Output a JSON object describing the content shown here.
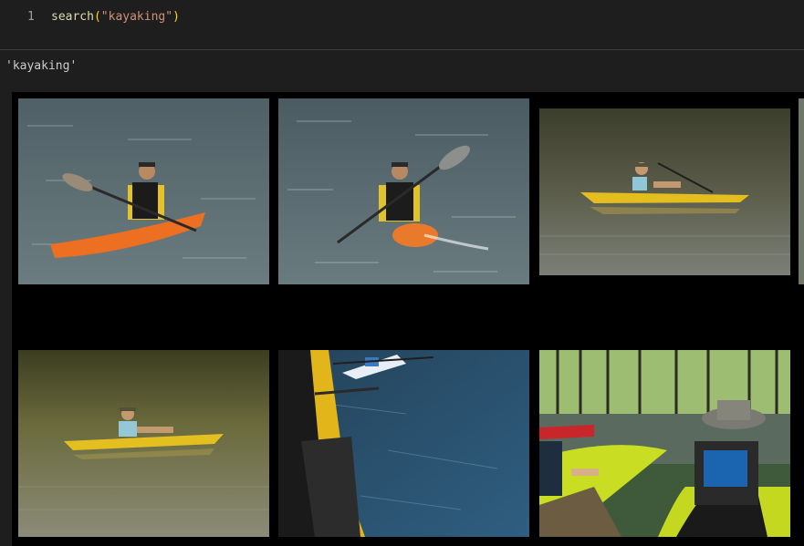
{
  "cell": {
    "line_number": "1",
    "code": {
      "fn": "search",
      "open": "(",
      "arg": "\"kayaking\"",
      "close": ")"
    }
  },
  "output": {
    "text": "'kayaking'"
  },
  "gallery": {
    "images": [
      {
        "name": "kayak-photo-1",
        "alt": "man paddling orange kayak"
      },
      {
        "name": "kayak-photo-2",
        "alt": "man paddling orange kayak toward camera"
      },
      {
        "name": "kayak-photo-3",
        "alt": "person in yellow kayak on calm river"
      },
      {
        "name": "kayak-photo-4",
        "alt": "person in yellow kayak reflecting trees"
      },
      {
        "name": "kayak-photo-5",
        "alt": "kayak bow on blue water"
      },
      {
        "name": "kayak-photo-6",
        "alt": "kayakers resting on shore"
      }
    ]
  },
  "colors": {
    "background": "#1e1e1e",
    "gallery_bg": "#000000"
  }
}
